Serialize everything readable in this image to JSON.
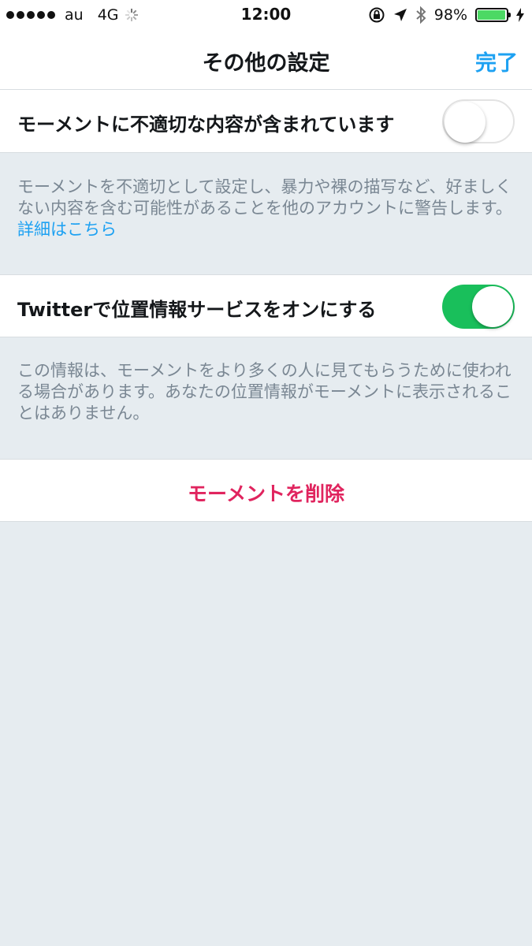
{
  "status_bar": {
    "carrier": "au",
    "network": "4G",
    "time": "12:00",
    "battery": "98%",
    "battery_level": 0.98,
    "icons": [
      "signal-dots-icon",
      "activity-spinner-icon",
      "rotation-lock-icon",
      "location-arrow-icon",
      "bluetooth-icon",
      "battery-icon",
      "charging-bolt-icon"
    ]
  },
  "nav": {
    "title": "その他の設定",
    "done_label": "完了"
  },
  "settings": [
    {
      "label": "モーメントに不適切な内容が含まれています",
      "toggle_on": false,
      "note": "モーメントを不適切として設定し、暴力や裸の描写など、好ましくない内容を含む可能性があることを他のアカウントに警告します。",
      "link_text": "詳細はこちら"
    },
    {
      "label": "Twitterで位置情報サービスをオンにする",
      "toggle_on": true,
      "note": "この情報は、モーメントをより多くの人に見てもらうために使われる場合があります。あなたの位置情報がモーメントに表示されることはありません。"
    }
  ],
  "delete_label": "モーメントを削除",
  "colors": {
    "accent": "#1da1f2",
    "destructive": "#e0245e",
    "toggle_on": "#19bf5b",
    "background": "#e6ecf0"
  }
}
